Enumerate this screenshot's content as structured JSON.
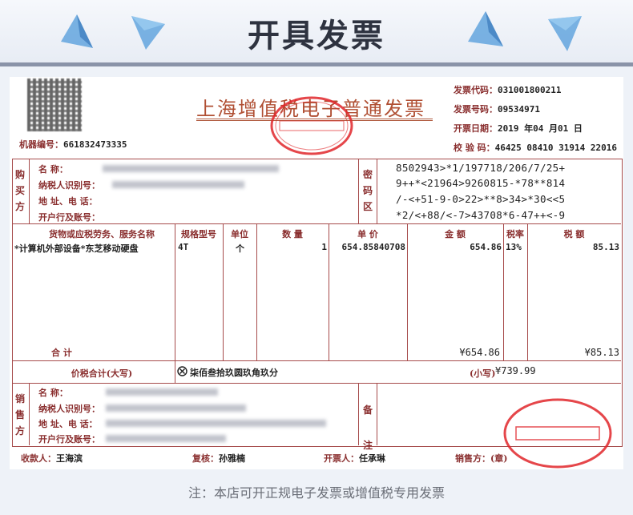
{
  "banner": {
    "title": "开具发票"
  },
  "invoice": {
    "title": "上海增值税电子普通发票",
    "machine_label": "机器编号：",
    "machine_no": "661832473335",
    "code_label": "发票代码：",
    "code": "031001800211",
    "number_label": "发票号码：",
    "number": "09534971",
    "date_label": "开票日期：",
    "date": "2019 年04 月01 日",
    "check_label": "校  验  码：",
    "check": "46425 08410 31914 22016"
  },
  "buyer": {
    "side": "购买方",
    "fields": [
      "名    称：",
      "纳税人识别号：",
      "地  址、电  话：",
      "开户行及账号："
    ]
  },
  "cipher": {
    "label": "密码区",
    "lines": [
      "8502943>*1/197718/206/7/25+",
      "9++*<21964>9260815-*78**814",
      "/-<+51-9-0>22>**8>34>*30<<5",
      "*2/<+88/<-7>43708*6-47++<-9"
    ]
  },
  "items": {
    "headers": [
      "货物或应税劳务、服务名称",
      "规格型号",
      "单位",
      "数  量",
      "单  价",
      "金  额",
      "税率",
      "税  额"
    ],
    "rows": [
      {
        "name": "*计算机外部设备*东芝移动硬盘",
        "spec": "4T",
        "unit": "个",
        "qty": "1",
        "price": "654.85840708",
        "amount": "654.86",
        "rate": "13%",
        "tax": "85.13"
      }
    ],
    "subtotal_label": "合        计",
    "subtotal_amount": "¥654.86",
    "subtotal_tax": "¥85.13"
  },
  "grand_total": {
    "label": "价税合计(大写)",
    "upper_icon": "circle-x-icon",
    "upper": "柒佰叁拾玖圆玖角玖分",
    "small_label": "(小写)",
    "small": "¥739.99"
  },
  "seller": {
    "side": "销售方",
    "fields": [
      "名    称：",
      "纳税人识别号：",
      "地  址、电  话：",
      "开户行及账号："
    ],
    "remarks_label": "备注"
  },
  "signatures": {
    "payee_label": "收款人：",
    "payee": "王海滨",
    "reviewer_label": "复核：",
    "reviewer": "孙雅楠",
    "drawer_label": "开票人：",
    "drawer": "任承琳",
    "seller_label": "销售方：(章)"
  },
  "footer": {
    "note": "注：本店可开正规电子发票或增值税专用发票"
  },
  "colors": {
    "ink": "#a64b4b",
    "stamp": "#e0262a",
    "title": "#b04f33",
    "banner_text": "#2e3340"
  }
}
